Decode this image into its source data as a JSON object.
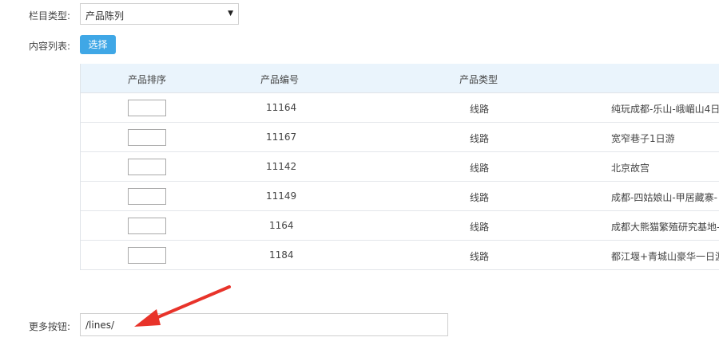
{
  "form": {
    "category_label": "栏目类型:",
    "category_value": "产品陈列",
    "content_list_label": "内容列表:",
    "select_button": "选择",
    "more_button_label": "更多按钮:",
    "more_button_value": "/lines/"
  },
  "table": {
    "headers": [
      "产品排序",
      "产品编号",
      "产品类型"
    ],
    "rows": [
      {
        "id": "11164",
        "type": "线路",
        "name": "纯玩成都-乐山-峨嵋山4日"
      },
      {
        "id": "11167",
        "type": "线路",
        "name": "宽窄巷子1日游"
      },
      {
        "id": "11142",
        "type": "线路",
        "name": "北京故宫"
      },
      {
        "id": "11149",
        "type": "线路",
        "name": "成都-四姑娘山-甲居藏寨-"
      },
      {
        "id": "1164",
        "type": "线路",
        "name": "成都大熊猫繁殖研究基地-"
      },
      {
        "id": "1184",
        "type": "线路",
        "name": "都江堰+青城山豪华一日游"
      }
    ]
  },
  "colors": {
    "accent": "#3fa7e6",
    "table_header_bg": "#eaf4fc",
    "annotation_arrow": "#e8332a"
  }
}
